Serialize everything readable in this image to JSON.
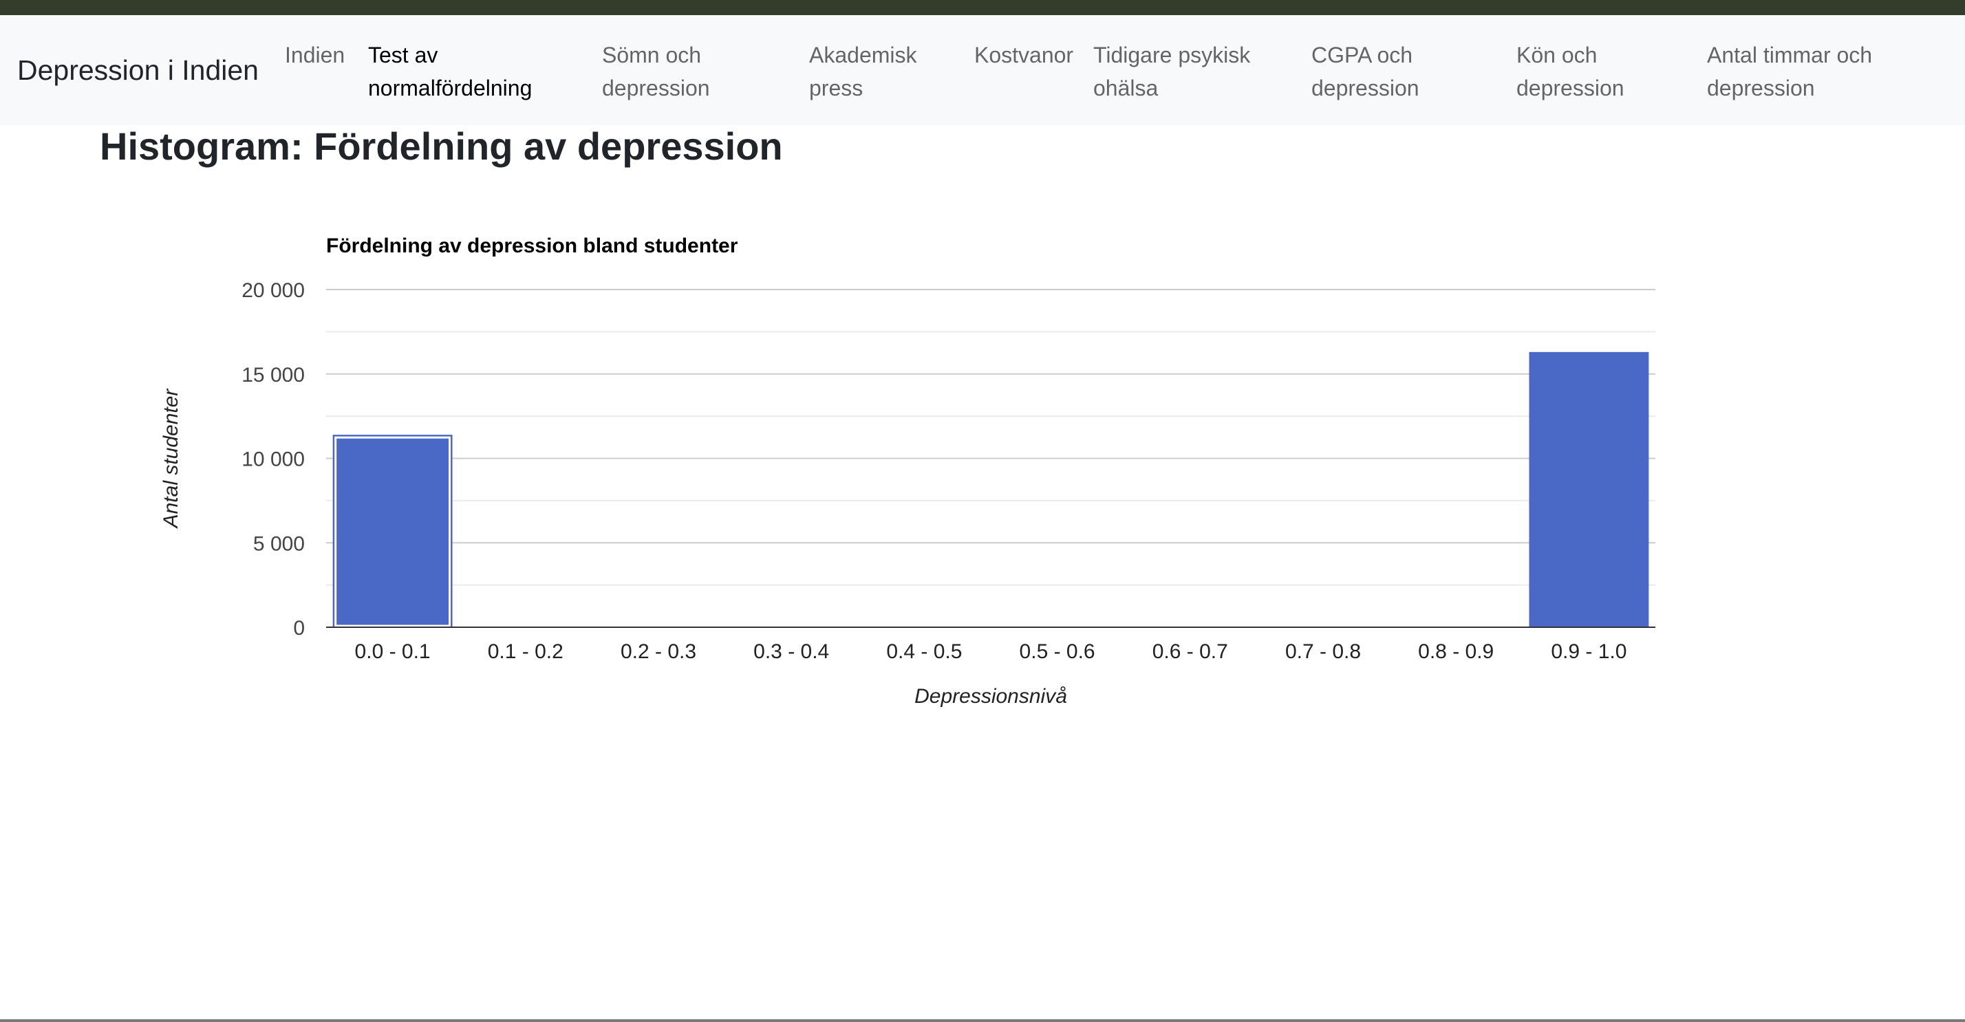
{
  "navbar": {
    "brand": "Depression i Indien",
    "items": [
      {
        "label": "Indien",
        "active": false
      },
      {
        "label": "Test av normalfördelning",
        "active": true
      },
      {
        "label": "Sömn och depression",
        "active": false
      },
      {
        "label": "Akademisk press",
        "active": false
      },
      {
        "label": "Kostvanor",
        "active": false
      },
      {
        "label": "Tidigare psykisk ohälsa",
        "active": false
      },
      {
        "label": "CGPA och depression",
        "active": false
      },
      {
        "label": "Kön och depression",
        "active": false
      },
      {
        "label": "Antal timmar och depression",
        "active": false
      }
    ]
  },
  "page": {
    "title": "Histogram: Fördelning av depression"
  },
  "colors": {
    "bar": "#4a68c6",
    "grid": "#cccccc",
    "minor_grid": "#ebebeb",
    "axis": "#333333"
  },
  "chart_data": {
    "type": "bar",
    "title": "Fördelning av depression bland studenter",
    "xlabel": "Depressionsnivå",
    "ylabel": "Antal studenter",
    "categories": [
      "0.0 - 0.1",
      "0.1 - 0.2",
      "0.2 - 0.3",
      "0.3 - 0.4",
      "0.4 - 0.5",
      "0.5 - 0.6",
      "0.6 - 0.7",
      "0.7 - 0.8",
      "0.8 - 0.9",
      "0.9 - 1.0"
    ],
    "values": [
      11400,
      0,
      0,
      0,
      0,
      0,
      0,
      0,
      0,
      16300
    ],
    "ylim": [
      0,
      20000
    ],
    "yticks": [
      0,
      5000,
      10000,
      15000,
      20000
    ],
    "ytick_labels": [
      "0",
      "5 000",
      "10 000",
      "15 000",
      "20 000"
    ],
    "grid": true,
    "legend": false
  }
}
